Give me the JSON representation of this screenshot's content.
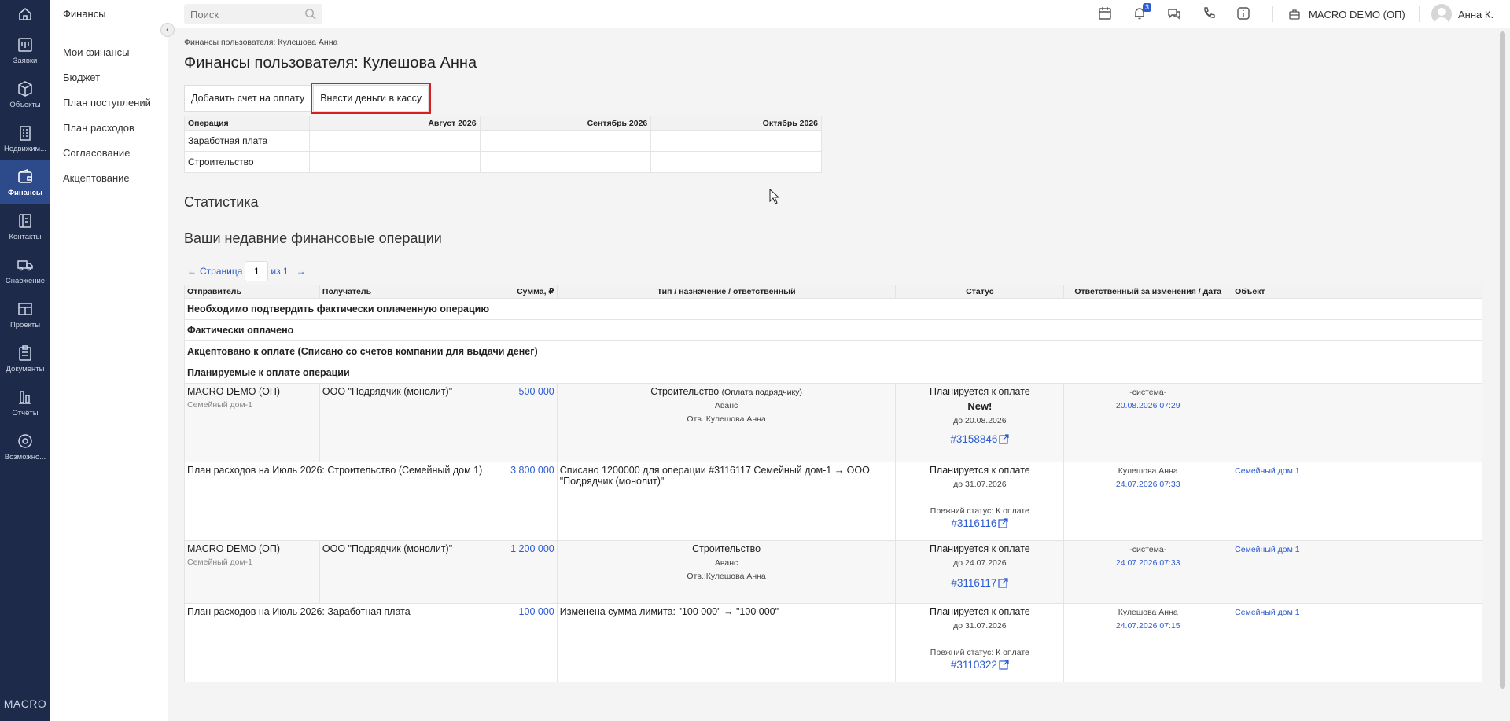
{
  "rail": {
    "items": [
      {
        "label": "Заявки",
        "icon": "tasks-icon"
      },
      {
        "label": "Объекты",
        "icon": "cube-icon"
      },
      {
        "label": "Недвижим...",
        "icon": "building-icon"
      },
      {
        "label": "Финансы",
        "icon": "wallet-icon"
      },
      {
        "label": "Контакты",
        "icon": "contacts-icon"
      },
      {
        "label": "Снабжение",
        "icon": "truck-icon"
      },
      {
        "label": "Проекты",
        "icon": "projects-icon"
      },
      {
        "label": "Документы",
        "icon": "clipboard-icon"
      },
      {
        "label": "Отчёты",
        "icon": "chart-icon"
      },
      {
        "label": "Возможно...",
        "icon": "settings-icon"
      }
    ],
    "brand": "MACRO"
  },
  "subnav": {
    "title": "Финансы",
    "items": [
      "Мои финансы",
      "Бюджет",
      "План поступлений",
      "План расходов",
      "Согласование",
      "Акцептование"
    ]
  },
  "topbar": {
    "search_placeholder": "Поиск",
    "notifications_count": "3",
    "company": "MACRO DEMO (ОП)",
    "user": "Анна К."
  },
  "main": {
    "breadcrumb": "Финансы пользователя: Кулешова Анна",
    "title": "Финансы пользователя: Кулешова Анна",
    "buttons": {
      "add_invoice": "Добавить счет на оплату",
      "deposit_cash": "Внести деньги в кассу"
    },
    "ops_table": {
      "headers": [
        "Операция",
        "Август 2026",
        "Сентябрь 2026",
        "Октябрь 2026"
      ],
      "rows": [
        "Заработная плата",
        "Строительство"
      ]
    },
    "statistics_heading": "Статистика",
    "recent_heading": "Ваши недавние финансовые операции",
    "pager": {
      "prev": "←",
      "label": "Страница",
      "current": "1",
      "of": "из 1",
      "next": "→"
    },
    "tx_table": {
      "headers": [
        "Отправитель",
        "Получатель",
        "Сумма, ₽",
        "Тип / назначение / ответственный",
        "Статус",
        "Ответственный за изменения / дата",
        "Объект"
      ],
      "groups": [
        "Необходимо подтвердить фактически оплаченную операцию",
        "Фактически оплачено",
        "Акцептовано к оплате (Списано со счетов компании для выдачи денег)",
        "Планируемые к оплате операции"
      ],
      "rows": [
        {
          "sender": "MACRO DEMO (ОП)",
          "sender_sub": "Семейный дом-1",
          "recipient": "ООО \"Подрядчик (монолит)\"",
          "amount": "500 000",
          "type": "Строительство",
          "type_note": "(Оплата подрядчику)",
          "kind": "Аванс",
          "responsible": "Отв.:Кулешова Анна",
          "status": "Планируется к оплате",
          "status_new": "New!",
          "due": "до 20.08.2026",
          "prev_status": "",
          "id": "#3158846",
          "changed_by": "-система-",
          "changed_at": "20.08.2026 07:29",
          "object": ""
        },
        {
          "sender": "План расходов на Июль 2026: Строительство (Семейный дом 1)",
          "sender_sub": "",
          "recipient": "",
          "amount": "3 800 000",
          "type": "Списано 1200000 для операции #3116117 Семейный дом-1 → ООО \"Подрядчик (монолит)\"",
          "status": "Планируется к оплате",
          "due": "до 31.07.2026",
          "prev_status": "Прежний статус: К оплате",
          "id": "#3116116",
          "changed_by": "Кулешова Анна",
          "changed_at": "24.07.2026 07:33",
          "object": "Семейный дом 1"
        },
        {
          "sender": "MACRO DEMO (ОП)",
          "sender_sub": "Семейный дом-1",
          "recipient": "ООО \"Подрядчик (монолит)\"",
          "amount": "1 200 000",
          "type": "Строительство",
          "kind": "Аванс",
          "responsible": "Отв.:Кулешова Анна",
          "status": "Планируется к оплате",
          "due": "до 24.07.2026",
          "id": "#3116117",
          "changed_by": "-система-",
          "changed_at": "24.07.2026 07:33",
          "object": "Семейный дом 1"
        },
        {
          "sender": "План расходов на Июль 2026: Заработная плата",
          "amount": "100 000",
          "type": "Изменена сумма лимита: \"100 000\" → \"100 000\"",
          "status": "Планируется к оплате",
          "due": "до 31.07.2026",
          "prev_status": "Прежний статус: К оплате",
          "id": "#3110322",
          "changed_by": "Кулешова Анна",
          "changed_at": "24.07.2026 07:15",
          "object": "Семейный дом 1"
        }
      ]
    }
  }
}
